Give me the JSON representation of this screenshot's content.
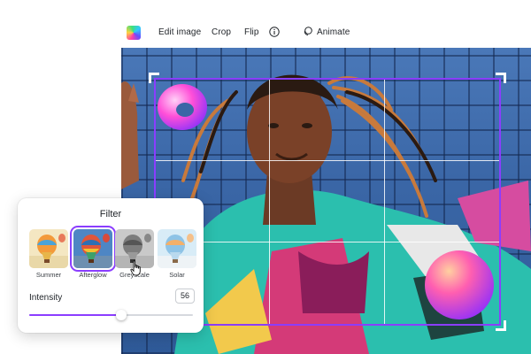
{
  "toolbar": {
    "items": {
      "edit_image": "Edit image",
      "crop": "Crop",
      "flip": "Flip",
      "animate": "Animate"
    },
    "icons": [
      "logo-icon",
      "info-icon",
      "animate-icon"
    ]
  },
  "filter_panel": {
    "title": "Filter",
    "filters": [
      {
        "label": "Summer",
        "selected": false
      },
      {
        "label": "Afterglow",
        "selected": true
      },
      {
        "label": "Greyscale",
        "selected": false
      },
      {
        "label": "Solar",
        "selected": false
      }
    ],
    "intensity": {
      "label": "Intensity",
      "value": "56",
      "fraction": 0.56
    }
  },
  "colors": {
    "accent": "#8b3dff",
    "sky": "#3a66a6"
  }
}
